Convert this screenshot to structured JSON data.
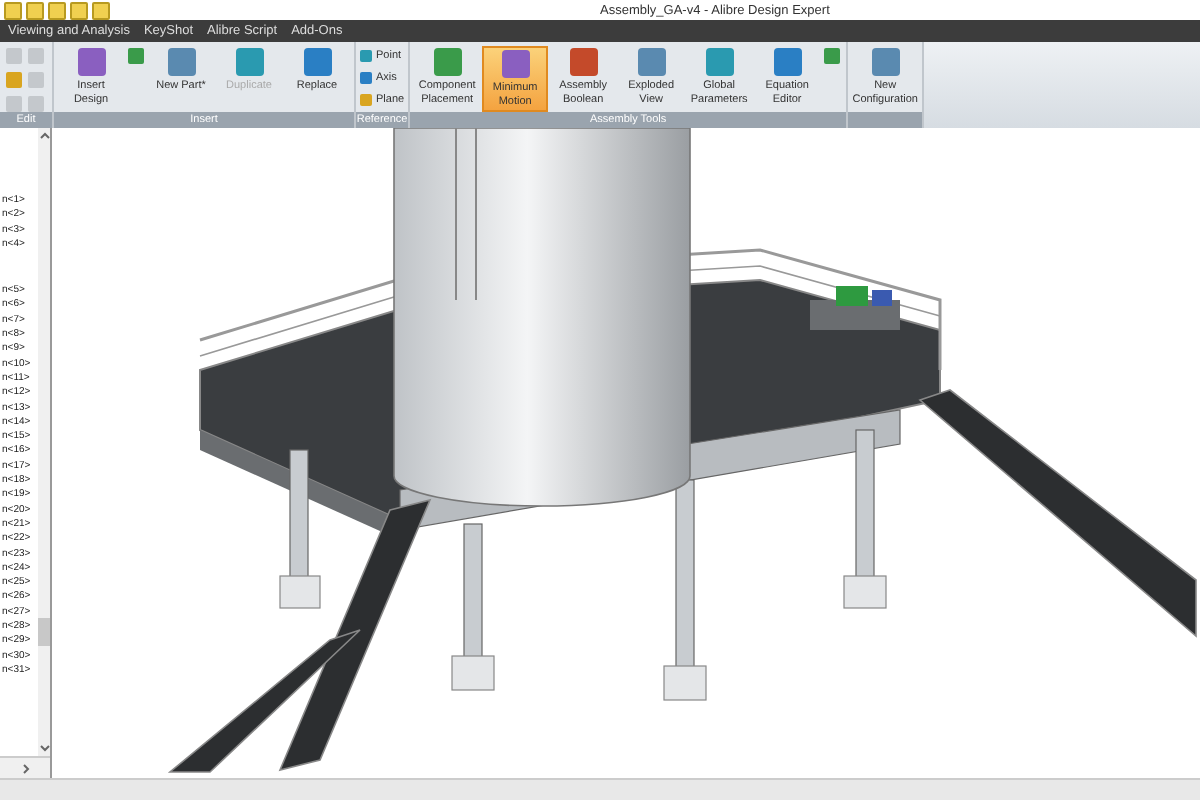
{
  "window": {
    "title": "Assembly_GA-v4 - Alibre Design Expert"
  },
  "menu": [
    "Viewing and Analysis",
    "KeyShot",
    "Alibre Script",
    "Add-Ons"
  ],
  "ribbon": {
    "groups": [
      {
        "label": "Edit",
        "buttons": [
          {
            "kind": "icon",
            "selected": false,
            "disabled": true
          },
          {
            "kind": "icon",
            "selected": false,
            "disabled": false
          },
          {
            "kind": "icon",
            "selected": false,
            "disabled": true
          },
          {
            "kind": "icon",
            "selected": false,
            "disabled": true
          },
          {
            "kind": "icon",
            "selected": false,
            "disabled": true
          },
          {
            "kind": "icon",
            "selected": false,
            "disabled": true
          }
        ]
      },
      {
        "label": "Insert",
        "buttons": [
          {
            "kind": "large",
            "label": "Insert Design",
            "selected": false,
            "disabled": false
          },
          {
            "kind": "icon",
            "selected": false,
            "disabled": false
          },
          {
            "kind": "large",
            "label": "New Part*",
            "selected": false,
            "disabled": false
          },
          {
            "kind": "large",
            "label": "Duplicate",
            "selected": false,
            "disabled": true
          },
          {
            "kind": "large",
            "label": "Replace",
            "selected": false,
            "disabled": false
          }
        ]
      },
      {
        "label": "Reference",
        "buttons": [
          {
            "kind": "small",
            "label": "Point",
            "selected": false,
            "disabled": false
          },
          {
            "kind": "small",
            "label": "Axis",
            "selected": false,
            "disabled": false
          },
          {
            "kind": "small",
            "label": "Plane",
            "selected": false,
            "disabled": false
          }
        ]
      },
      {
        "label": "Assembly Tools",
        "buttons": [
          {
            "kind": "large",
            "label": "Component Placement",
            "selected": false,
            "disabled": false
          },
          {
            "kind": "large",
            "label": "Minimum Motion",
            "selected": true,
            "disabled": false
          },
          {
            "kind": "large",
            "label": "Assembly Boolean",
            "selected": false,
            "disabled": false
          },
          {
            "kind": "large",
            "label": "Exploded View",
            "selected": false,
            "disabled": false
          },
          {
            "kind": "large",
            "label": "Global Parameters",
            "selected": false,
            "disabled": false
          },
          {
            "kind": "large",
            "label": "Equation Editor",
            "selected": false,
            "disabled": false
          },
          {
            "kind": "icon",
            "selected": false,
            "disabled": false
          }
        ]
      },
      {
        "buttons": [
          {
            "kind": "large",
            "label": "New Configuration",
            "selected": false,
            "disabled": false
          }
        ]
      }
    ]
  },
  "tree": {
    "sections": [
      {
        "items": [
          "n<1>",
          "n<2>",
          "n<3>",
          "n<4>"
        ]
      },
      {
        "items": [
          "n<5>",
          "n<6>",
          "n<7>",
          "n<8>",
          "n<9>",
          "n<10>",
          "n<11>",
          "n<12>",
          "n<13>",
          "n<14>",
          "n<15>",
          "n<16>",
          "n<17>",
          "n<18>",
          "n<19>",
          "n<20>",
          "n<21>",
          "n<22>",
          "n<23>",
          "n<24>",
          "n<25>",
          "n<26>",
          "n<27>",
          "n<28>",
          "n<29>",
          "n<30>",
          "n<31>"
        ]
      }
    ]
  }
}
